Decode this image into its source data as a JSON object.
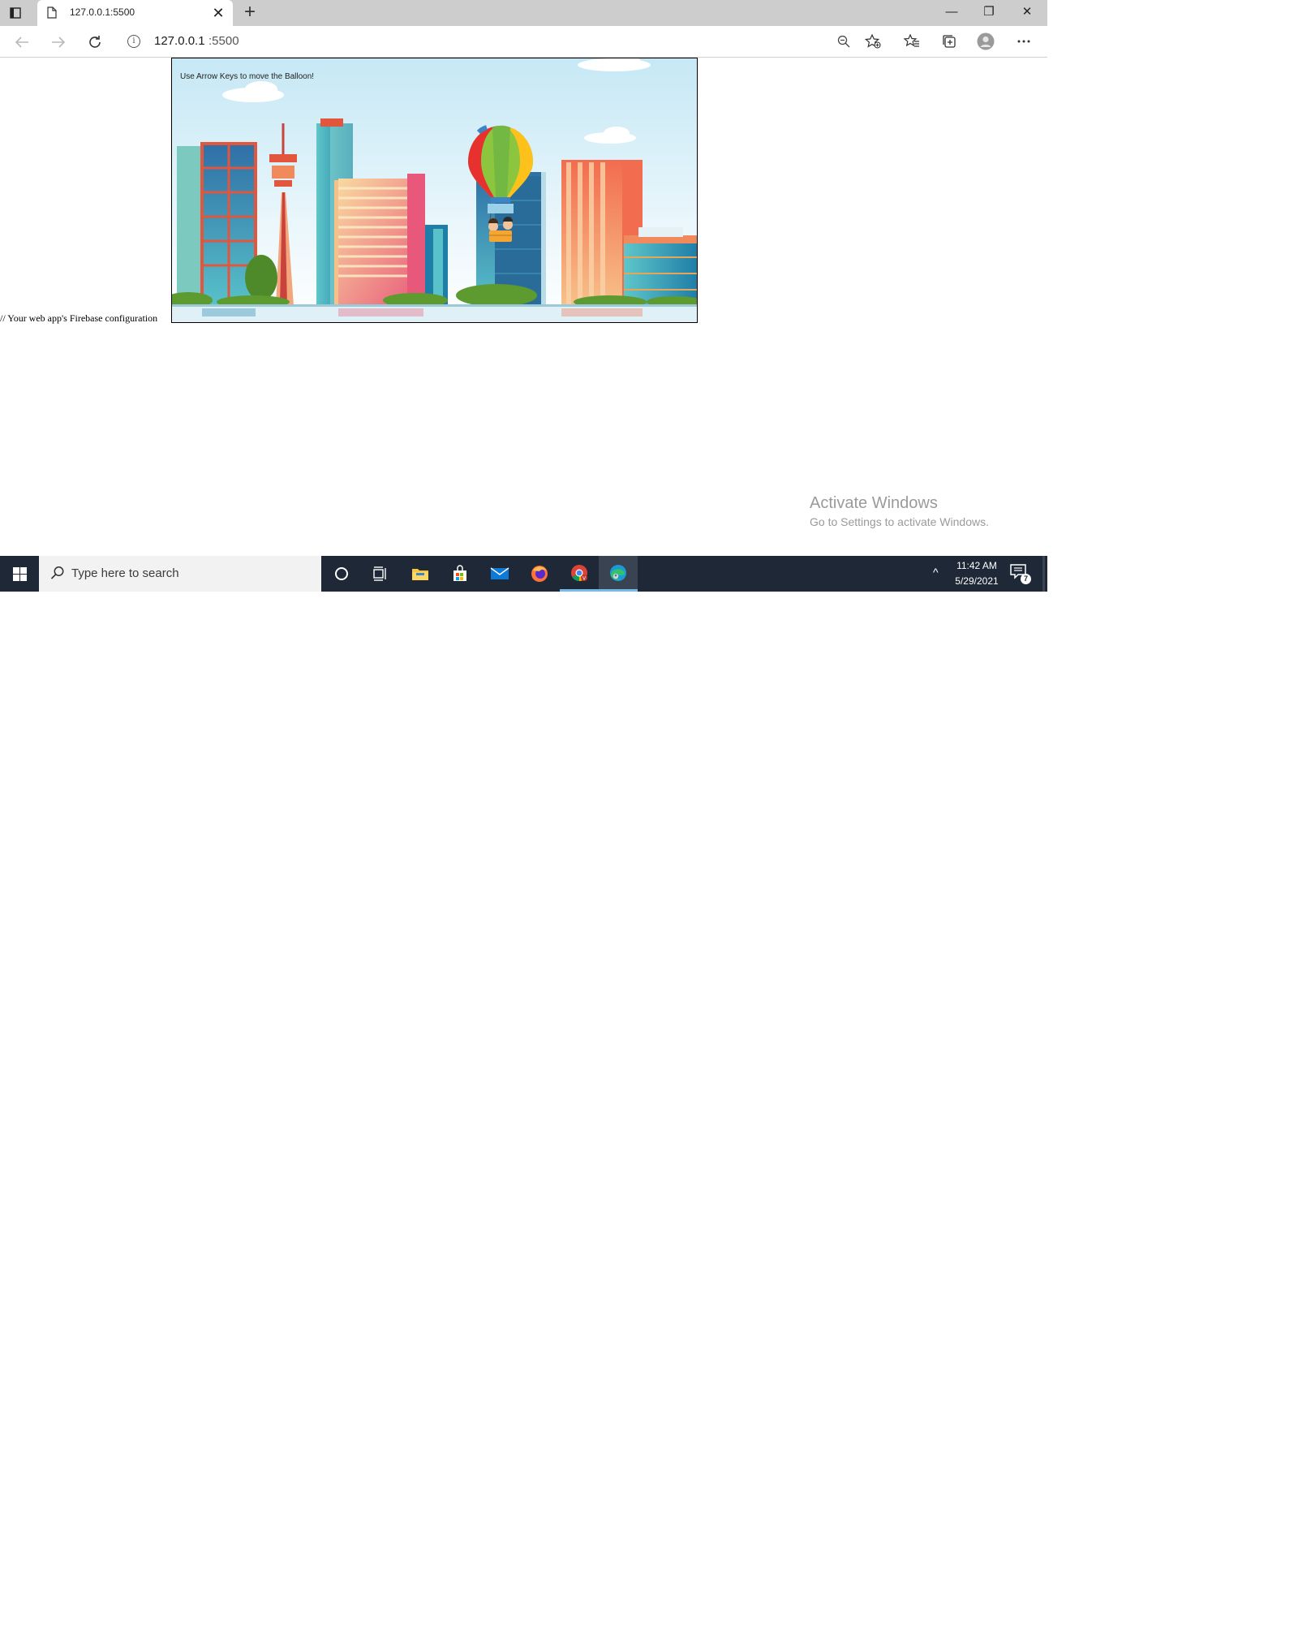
{
  "browser": {
    "tab": {
      "title": "127.0.0.1:5500",
      "close_glyph": "✕"
    },
    "new_tab_glyph": "+",
    "window_controls": {
      "minimize": "—",
      "restore": "❐",
      "close": "✕"
    },
    "address": {
      "info_glyph": "i",
      "host": "127.0.0.1",
      "port": ":5500"
    },
    "toolbar_icons": [
      "zoom-out-icon",
      "add-favorite-icon",
      "favorites-icon",
      "collections-icon",
      "profile-icon",
      "more-icon"
    ]
  },
  "page": {
    "firebase_comment": "// Your web app's Firebase configuration",
    "game": {
      "instruction": "Use Arrow Keys to move the Balloon!"
    }
  },
  "watermark": {
    "title": "Activate Windows",
    "subtitle": "Go to Settings to activate Windows."
  },
  "taskbar": {
    "search_placeholder": "Type here to search",
    "apps": [
      "cortana-icon",
      "task-view-icon",
      "file-explorer-icon",
      "microsoft-store-icon",
      "mail-icon",
      "firefox-icon",
      "chrome-icon",
      "edge-icon"
    ],
    "tray": {
      "chevron": "^",
      "time": "11:42 AM",
      "date": "5/29/2021",
      "notification_count": "7"
    }
  },
  "colors": {
    "taskbar": "#1f2836",
    "tabstrip": "#cdcdcd",
    "sky_top": "#c8e8f4",
    "sky_bottom": "#ffffff"
  }
}
